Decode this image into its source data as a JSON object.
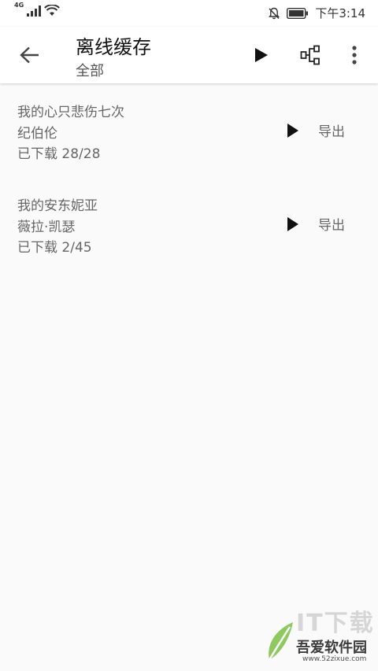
{
  "status_bar": {
    "network": "4G",
    "time": "下午3:14"
  },
  "app_bar": {
    "title": "离线缓存",
    "subtitle": "全部",
    "icons": [
      "back-arrow-icon",
      "play-icon",
      "tree-icon",
      "more-vert-icon"
    ]
  },
  "items": [
    {
      "title": "我的心只悲伤七次",
      "artist": "纪伯伦",
      "progress": "已下载 28/28",
      "export_label": "导出"
    },
    {
      "title": "我的安东妮亚",
      "artist": "薇拉·凯瑟",
      "progress": "已下载 2/45",
      "export_label": "导出"
    }
  ],
  "watermark": {
    "big": "IT下载",
    "name": "吾爱软件园",
    "url": "www.52zixue.com"
  }
}
